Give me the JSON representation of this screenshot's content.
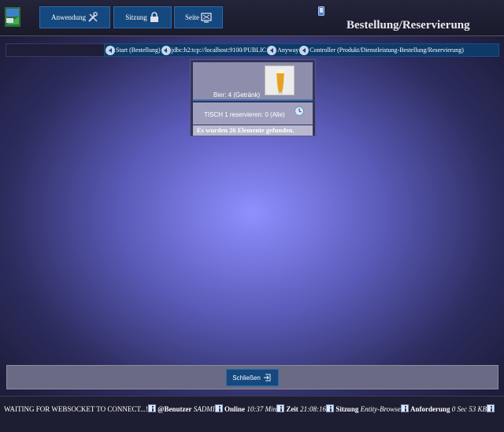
{
  "header": {
    "title": "Bestellung/Reservierung",
    "menu": [
      {
        "label": "Anwendung",
        "icon": "tools-icon"
      },
      {
        "label": "Sitzung",
        "icon": "lock-icon"
      },
      {
        "label": "Seite",
        "icon": "screen-icon"
      }
    ]
  },
  "breadcrumb": [
    "Start (Bestellung)",
    "jdbc:h2:tcp://localhost:9100/PUBLIC",
    "Anyway",
    "Controller (Produkt/Dienstleistung-Bestellung/Reservierung)"
  ],
  "panel": {
    "item_label": "Bier: 4 (Getränk)",
    "reserve_label": "TISCH 1 reservieren: 0 (Alle)",
    "result_text": "Es wurden 26 Elemente gefunden."
  },
  "footer": {
    "close_label": "Schließen"
  },
  "status": {
    "websocket": "WAITING FOR WEBSOCKET TO CONNECT...!",
    "user_key": "@Benutzer",
    "user_val": "SADMI",
    "online_key": "Online",
    "online_val": "10:37 Min",
    "time_key": "Zeit",
    "time_val": "21:08:16",
    "session_key": "Sitzung",
    "session_val": "Entity-Browse",
    "request_key": "Anforderung",
    "request_val": "0 Sec 53 KB"
  },
  "colors": {
    "button": "#14487e",
    "breadcrumb": "#0e3a68",
    "accent": "#3b73b8"
  }
}
